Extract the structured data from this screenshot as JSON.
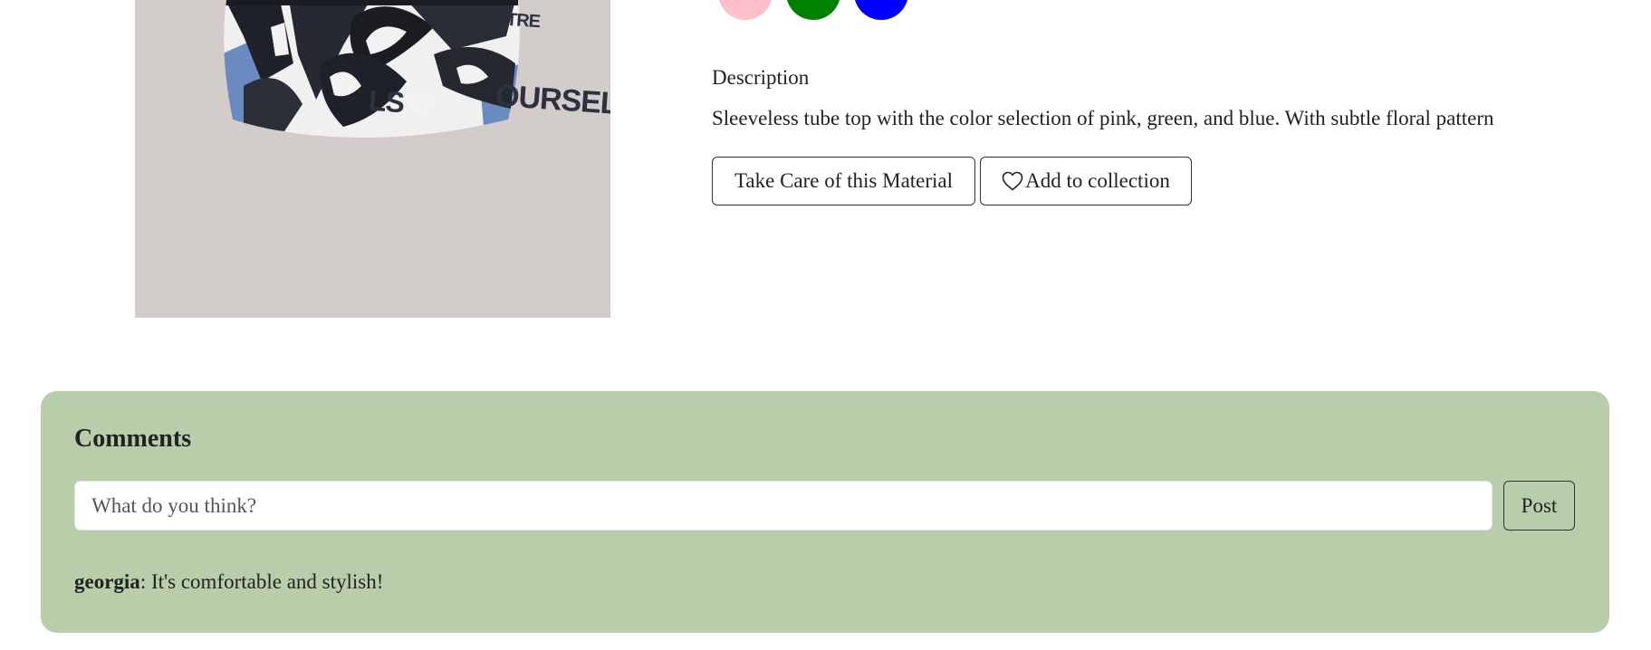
{
  "product": {
    "image_alt": "Sleeveless tube top with abstract black and white print",
    "print_text": [
      "OURSELF",
      "TRE",
      "LS"
    ],
    "swatches": [
      {
        "name": "pink",
        "color": "#ffc0cb"
      },
      {
        "name": "green",
        "color": "#008000"
      },
      {
        "name": "blue",
        "color": "#0000ff"
      }
    ],
    "description_heading": "Description",
    "description_text": "Sleeveless tube top with the color selection of pink, green, and blue. With subtle floral pattern",
    "care_button_label": "Take Care of this Material",
    "collection_button_label": "Add to collection"
  },
  "comments": {
    "title": "Comments",
    "input_placeholder": "What do you think?",
    "post_button_label": "Post",
    "items": [
      {
        "user": "georgia",
        "separator": ": ",
        "text": "It's comfortable and stylish!"
      }
    ]
  },
  "colors": {
    "panel_background": "#b8cdaa",
    "image_background": "#d2cdca"
  }
}
